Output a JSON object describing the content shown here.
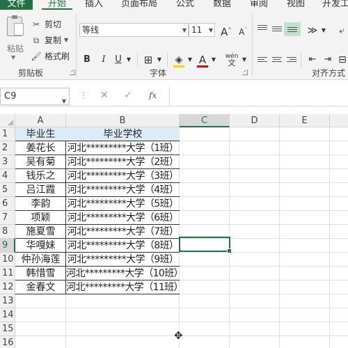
{
  "menu": {
    "tabs": [
      "文件",
      "开始",
      "插入",
      "页面布局",
      "公式",
      "数据",
      "审阅",
      "视图",
      "开发工"
    ],
    "active": "开始"
  },
  "ribbon": {
    "clipboard": {
      "paste": "粘贴",
      "cut": "剪切",
      "copy": "复制",
      "format_painter": "格式刷",
      "group_label": "剪贴板"
    },
    "font": {
      "font_name": "等线",
      "font_size": "11",
      "bold": "B",
      "italic": "I",
      "underline": "U",
      "group_label": "字体",
      "wen": "wén",
      "wen_char": "文",
      "grow": "A",
      "shrink": "A"
    },
    "alignment": {
      "group_label": "对齐方式"
    },
    "colors": {
      "font_color_bar": "#e00000",
      "fill_color_bar": "#ffd700"
    }
  },
  "formula_bar": {
    "name_box": "C9",
    "fx": "fx",
    "formula": ""
  },
  "grid": {
    "columns": [
      "A",
      "B",
      "C",
      "D",
      "E"
    ],
    "selected_column": "C",
    "row_numbers": [
      "1",
      "2",
      "3",
      "4",
      "5",
      "6",
      "7",
      "8",
      "9",
      "10",
      "11",
      "12",
      "13",
      "14",
      "15",
      "16"
    ],
    "selected_row": "9",
    "header": {
      "a": "毕业生",
      "b": "毕业学校"
    },
    "rows": [
      {
        "a": "姜花长",
        "b": "河北*********大学（1班）"
      },
      {
        "a": "吴有菊",
        "b": "河北*********大学（2班）"
      },
      {
        "a": "钱乐之",
        "b": "河北*********大学（3班）"
      },
      {
        "a": "吕江霞",
        "b": "河北*********大学（4班）"
      },
      {
        "a": "李韵",
        "b": "河北*********大学（5班）"
      },
      {
        "a": "项颖",
        "b": "河北*********大学（6班）"
      },
      {
        "a": "施夏雪",
        "b": "河北*********大学（7班）"
      },
      {
        "a": "华嘎妹",
        "b": "河北*********大学（8班）"
      },
      {
        "a": "仲孙海莲",
        "b": "河北*********大学（9班）"
      },
      {
        "a": "韩惜雪",
        "b": "河北*********大学（10班）"
      },
      {
        "a": "金春文",
        "b": "河北*********大学（11班）"
      }
    ],
    "accent": "#217346",
    "header_fill": "#ddebf7"
  }
}
